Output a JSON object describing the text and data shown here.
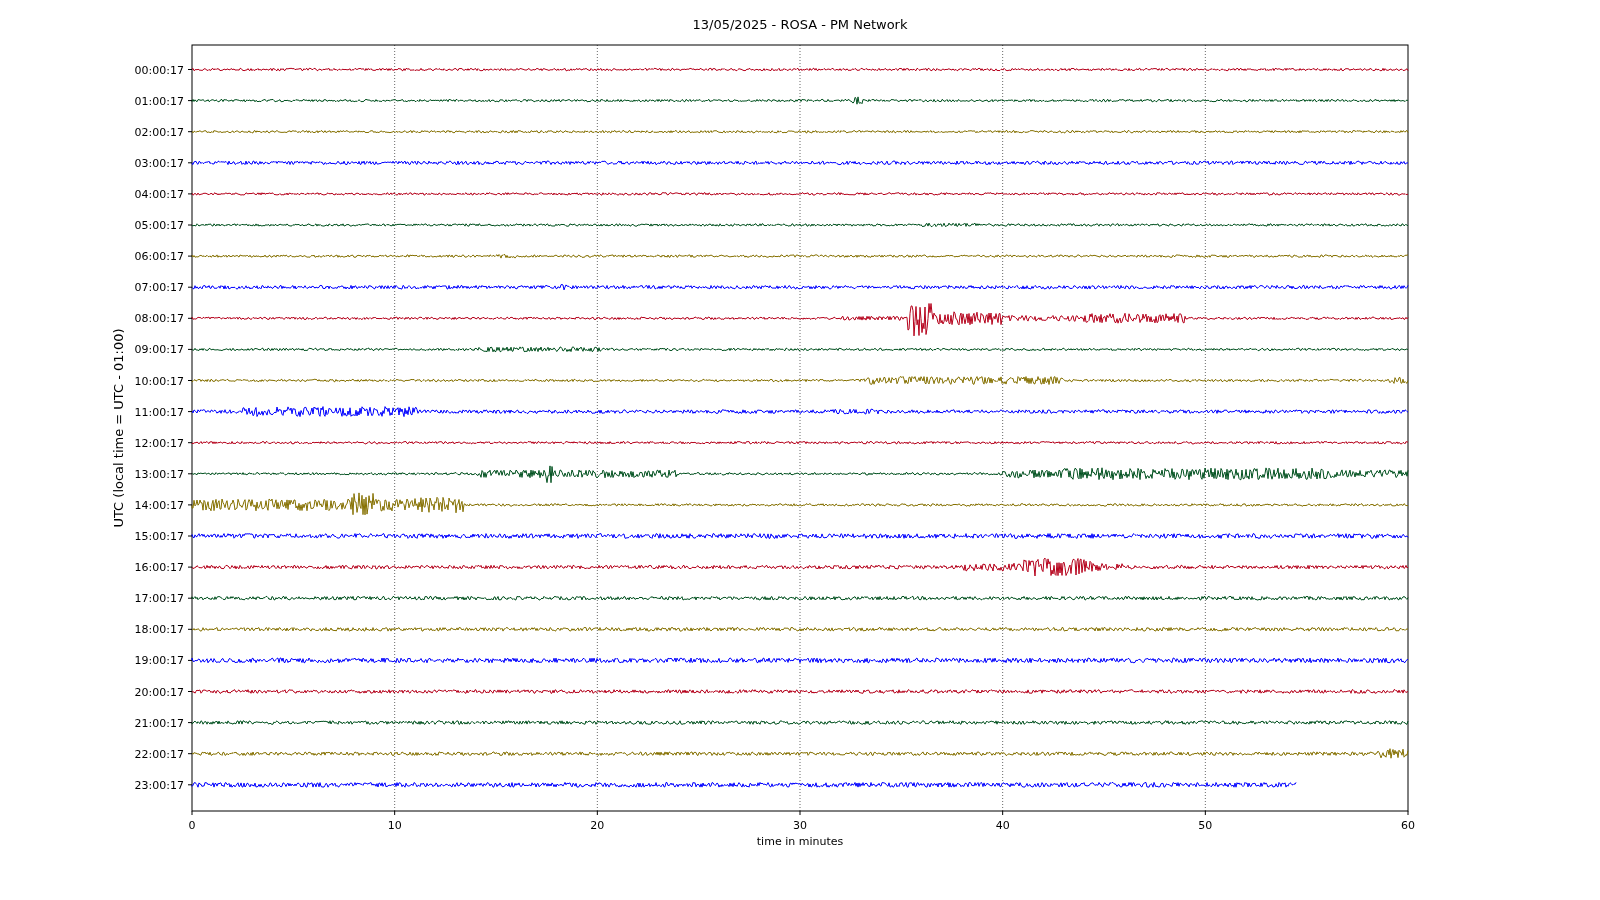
{
  "title": "13/05/2025 - ROSA - PM Network",
  "ylabel": "UTC (local time = UTC - 01:00)",
  "xlabel": "time in minutes",
  "xticks": [
    "0",
    "10",
    "20",
    "30",
    "40",
    "50",
    "60"
  ],
  "rows": [
    {
      "label": "00:00:17",
      "color": "#b5001a",
      "level": 1
    },
    {
      "label": "01:00:17",
      "color": "#00501e",
      "level": 1
    },
    {
      "label": "02:00:17",
      "color": "#857000",
      "level": 1
    },
    {
      "label": "03:00:17",
      "color": "#0000ff",
      "level": 1
    },
    {
      "label": "04:00:17",
      "color": "#b5001a",
      "level": 1
    },
    {
      "label": "05:00:17",
      "color": "#00501e",
      "level": 1
    },
    {
      "label": "06:00:17",
      "color": "#857000",
      "level": 1
    },
    {
      "label": "07:00:17",
      "color": "#0000ff",
      "level": 1
    },
    {
      "label": "08:00:17",
      "color": "#b5001a",
      "level": 1
    },
    {
      "label": "09:00:17",
      "color": "#00501e",
      "level": 1
    },
    {
      "label": "10:00:17",
      "color": "#857000",
      "level": 1
    },
    {
      "label": "11:00:17",
      "color": "#0000ff",
      "level": 1
    },
    {
      "label": "12:00:17",
      "color": "#b5001a",
      "level": 1
    },
    {
      "label": "13:00:17",
      "color": "#00501e",
      "level": 1
    },
    {
      "label": "14:00:17",
      "color": "#857000",
      "level": 1
    },
    {
      "label": "15:00:17",
      "color": "#0000ff",
      "level": 1
    },
    {
      "label": "16:00:17",
      "color": "#b5001a",
      "level": 1
    },
    {
      "label": "17:00:17",
      "color": "#00501e",
      "level": 1
    },
    {
      "label": "18:00:17",
      "color": "#857000",
      "level": 1
    },
    {
      "label": "19:00:17",
      "color": "#0000ff",
      "level": 1
    },
    {
      "label": "20:00:17",
      "color": "#b5001a",
      "level": 1
    },
    {
      "label": "21:00:17",
      "color": "#00501e",
      "level": 1
    },
    {
      "label": "22:00:17",
      "color": "#857000",
      "level": 1
    },
    {
      "label": "23:00:17",
      "color": "#0000ff",
      "level": 0.908
    }
  ]
}
